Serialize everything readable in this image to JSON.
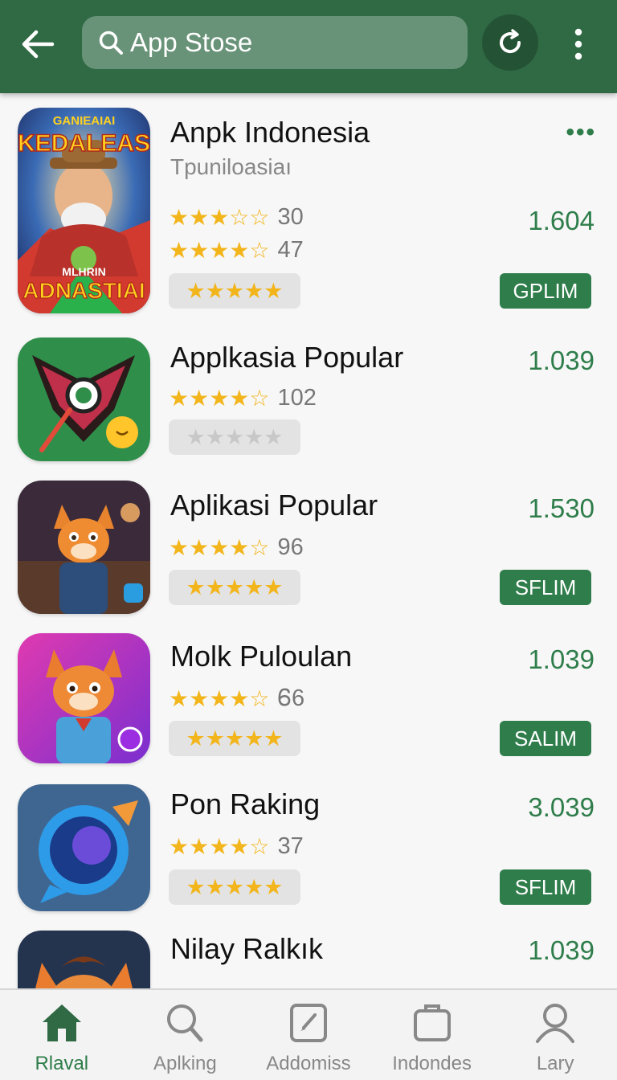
{
  "header": {
    "search_value": "App Stose",
    "icons": [
      "back-arrow-icon",
      "search-icon",
      "refresh-icon",
      "more-vert-icon"
    ]
  },
  "apps": [
    {
      "title": "Anpk Indonesia",
      "subtitle": "Tpuniloasiaı",
      "rating1_stars": "★★★☆☆",
      "rating1_count": "30",
      "rating2_stars": "★★★★☆",
      "rating2_count": "47",
      "box_stars": "★★★★★",
      "score": "1.604",
      "action": "GPLIM",
      "icon_text_top": "GANIEAIAI",
      "icon_text_title": "KEDALEAS",
      "icon_text_small": "MLHRIN",
      "icon_text_bottom": "ADNASTIAI",
      "more": "•••"
    },
    {
      "title": "Applkasia Popular",
      "rating_stars": "★★★★☆",
      "rating_count": "102",
      "box_stars": "★★★★★",
      "score": "1.039"
    },
    {
      "title": "Aplikasi Popular",
      "rating_stars": "★★★★☆",
      "rating_count": "96",
      "box_stars": "★★★★★",
      "score": "1.530",
      "action": "SFLIM"
    },
    {
      "title": "Molk Puloulan",
      "rating_stars": "★★★★☆",
      "rating_count": "Ꮾ6",
      "box_stars": "★★★★★",
      "score": "1.039",
      "action": "SALIM"
    },
    {
      "title": "Pon Raking",
      "rating_stars": "★★★★☆",
      "rating_count": "37",
      "box_stars": "★★★★★",
      "score": "3.039",
      "action": "SFLIM"
    },
    {
      "title": "Nilay Ralkık",
      "score": "1.039"
    }
  ],
  "nav": [
    {
      "label": "Rlaval",
      "icon": "home-icon",
      "active": true
    },
    {
      "label": "Aplking",
      "icon": "search-icon",
      "active": false
    },
    {
      "label": "Addomiss",
      "icon": "edit-icon",
      "active": false
    },
    {
      "label": "Indondes",
      "icon": "briefcase-icon",
      "active": false
    },
    {
      "label": "Lary",
      "icon": "person-icon",
      "active": false
    }
  ],
  "colors": {
    "header": "#2f6a44",
    "accent": "#2e7d4a",
    "star": "#f2b51b",
    "background": "#f7f7f7"
  }
}
